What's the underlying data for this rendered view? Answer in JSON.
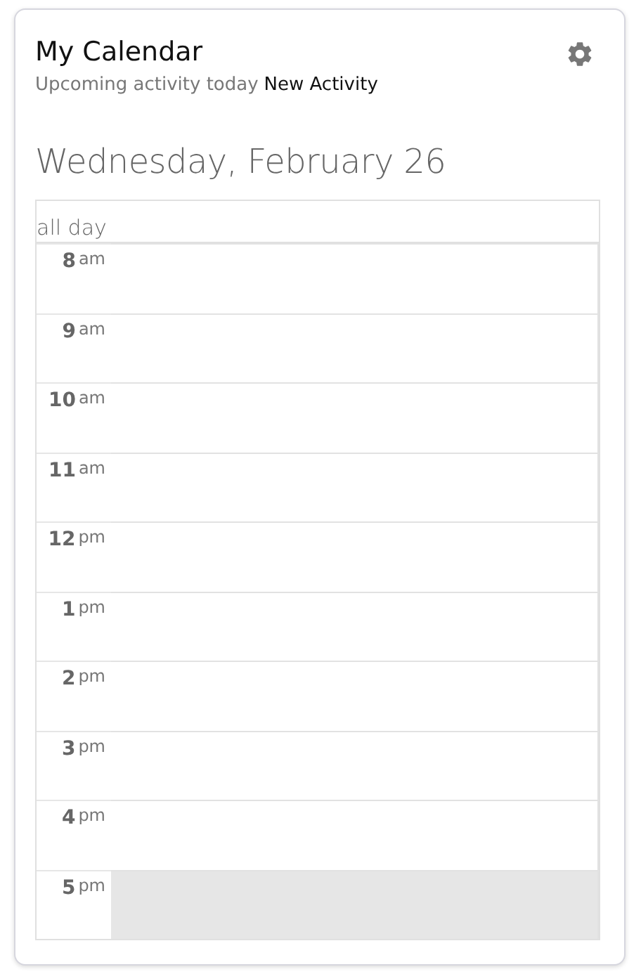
{
  "title": "My Calendar",
  "subtitle": {
    "label": "Upcoming activity today",
    "activity": "New Activity"
  },
  "date_heading": "Wednesday, February 26",
  "all_day_label": "all day",
  "slots": [
    {
      "hour": "8",
      "period": "am",
      "shaded": false
    },
    {
      "hour": "9",
      "period": "am",
      "shaded": false
    },
    {
      "hour": "10",
      "period": "am",
      "shaded": false
    },
    {
      "hour": "11",
      "period": "am",
      "shaded": false
    },
    {
      "hour": "12",
      "period": "pm",
      "shaded": false
    },
    {
      "hour": "1",
      "period": "pm",
      "shaded": false
    },
    {
      "hour": "2",
      "period": "pm",
      "shaded": false
    },
    {
      "hour": "3",
      "period": "pm",
      "shaded": false
    },
    {
      "hour": "4",
      "period": "pm",
      "shaded": false
    },
    {
      "hour": "5",
      "period": "pm",
      "shaded": true
    }
  ]
}
